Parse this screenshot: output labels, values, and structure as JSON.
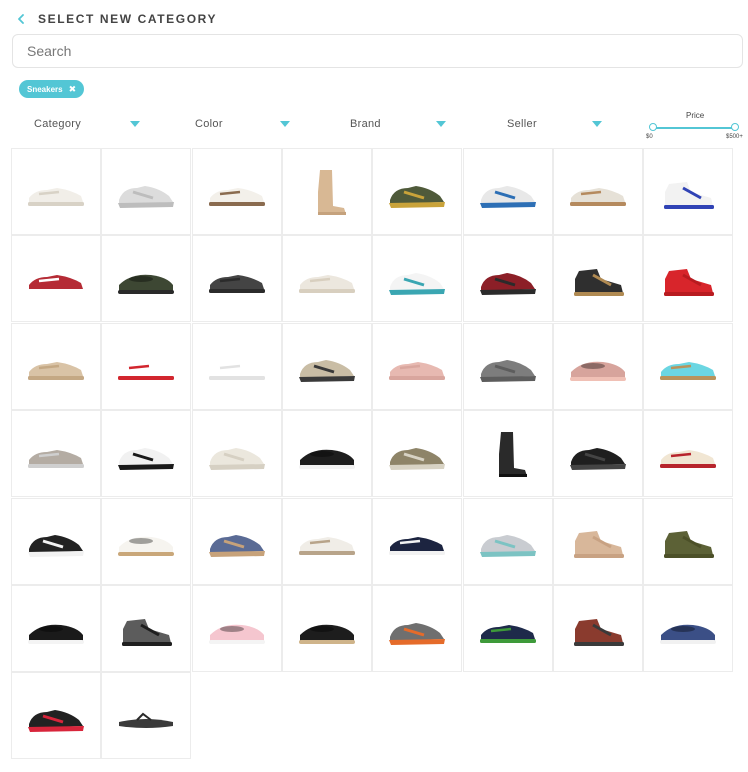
{
  "header": {
    "title": "SELECT NEW CATEGORY",
    "back_icon": "chevron-left-icon"
  },
  "search": {
    "placeholder": "Search",
    "value": ""
  },
  "active_filter": {
    "label": "Sneakers",
    "remove_icon": "close-icon"
  },
  "filters": [
    {
      "label": "Category"
    },
    {
      "label": "Color"
    },
    {
      "label": "Brand"
    },
    {
      "label": "Seller"
    }
  ],
  "price": {
    "label": "Price",
    "min_label": "$0",
    "max_label": "$500+"
  },
  "colors": {
    "accent": "#53c6d5"
  },
  "products": [
    {
      "kind": "sneaker",
      "colors": [
        "#f1eee8",
        "#d8d2c6"
      ]
    },
    {
      "kind": "runner",
      "colors": [
        "#dcdcdc",
        "#bdbdbd"
      ]
    },
    {
      "kind": "sneaker",
      "colors": [
        "#f3f0ea",
        "#8a6b4f"
      ]
    },
    {
      "kind": "boot",
      "colors": [
        "#d8b894",
        "#c5a27d"
      ]
    },
    {
      "kind": "runner",
      "colors": [
        "#4f5a3a",
        "#c9a33a"
      ]
    },
    {
      "kind": "runner",
      "colors": [
        "#e8e8e8",
        "#2d6fb5"
      ]
    },
    {
      "kind": "sneaker",
      "colors": [
        "#e6e1d7",
        "#b58a5e"
      ]
    },
    {
      "kind": "hightop",
      "colors": [
        "#f2f2f2",
        "#3043b5"
      ]
    },
    {
      "kind": "sneaker",
      "colors": [
        "#b52b35",
        "#ffffff"
      ]
    },
    {
      "kind": "slipon",
      "colors": [
        "#3d4733",
        "#2a2a2a"
      ]
    },
    {
      "kind": "sneaker",
      "colors": [
        "#444444",
        "#2b2b2b"
      ]
    },
    {
      "kind": "sneaker",
      "colors": [
        "#ece7de",
        "#d8cfbf"
      ]
    },
    {
      "kind": "runner",
      "colors": [
        "#f4f4f4",
        "#3aa6b2"
      ]
    },
    {
      "kind": "runner",
      "colors": [
        "#8c1f27",
        "#2b2b2b"
      ]
    },
    {
      "kind": "hightop",
      "colors": [
        "#2f2f2f",
        "#b08a52"
      ]
    },
    {
      "kind": "hightop",
      "colors": [
        "#d8252b",
        "#b81b20"
      ]
    },
    {
      "kind": "sneaker",
      "colors": [
        "#d9c3a6",
        "#c4a884"
      ]
    },
    {
      "kind": "sneaker",
      "colors": [
        "#ffffff",
        "#d2262e"
      ]
    },
    {
      "kind": "sneaker",
      "colors": [
        "#ffffff",
        "#e2e2e2"
      ]
    },
    {
      "kind": "runner",
      "colors": [
        "#c9bda5",
        "#3a3a3a"
      ]
    },
    {
      "kind": "sneaker",
      "colors": [
        "#e7b9b1",
        "#d9a69e"
      ]
    },
    {
      "kind": "runner",
      "colors": [
        "#7d7d7d",
        "#5d5d5d"
      ]
    },
    {
      "kind": "slipon",
      "colors": [
        "#d7a49c",
        "#f0c0b5"
      ]
    },
    {
      "kind": "sneaker",
      "colors": [
        "#6bd6e2",
        "#b9935b"
      ]
    },
    {
      "kind": "sneaker",
      "colors": [
        "#b4aca3",
        "#cfcfcf"
      ]
    },
    {
      "kind": "runner",
      "colors": [
        "#f1f1f1",
        "#1a1a1a"
      ]
    },
    {
      "kind": "runner",
      "colors": [
        "#ebe7dd",
        "#d6d0c3"
      ]
    },
    {
      "kind": "slipon",
      "colors": [
        "#1e1e1e",
        "#f3f3f3"
      ]
    },
    {
      "kind": "runner",
      "colors": [
        "#8e8468",
        "#d8d3c4"
      ]
    },
    {
      "kind": "boot",
      "colors": [
        "#2a2a2a",
        "#111111"
      ]
    },
    {
      "kind": "runner",
      "colors": [
        "#1f1f1f",
        "#444444"
      ]
    },
    {
      "kind": "sneaker",
      "colors": [
        "#f1e6d3",
        "#b7242c"
      ]
    },
    {
      "kind": "runner",
      "colors": [
        "#222222",
        "#f2f2f2"
      ]
    },
    {
      "kind": "slipon",
      "colors": [
        "#f6f4ef",
        "#c9a77a"
      ]
    },
    {
      "kind": "runner",
      "colors": [
        "#5a6b95",
        "#c7a27a"
      ]
    },
    {
      "kind": "sneaker",
      "colors": [
        "#f0ede7",
        "#b8a48a"
      ]
    },
    {
      "kind": "sneaker",
      "colors": [
        "#1c2440",
        "#f2f2f2"
      ]
    },
    {
      "kind": "runner",
      "colors": [
        "#c9ccd1",
        "#7cc3c3"
      ]
    },
    {
      "kind": "hightop",
      "colors": [
        "#d8b79a",
        "#c8a283"
      ]
    },
    {
      "kind": "hightop",
      "colors": [
        "#5c6136",
        "#4c5028"
      ]
    },
    {
      "kind": "slipon",
      "colors": [
        "#1a1a1a",
        "#f4f4f4"
      ]
    },
    {
      "kind": "hightop",
      "colors": [
        "#5c5c5c",
        "#1f1f1f"
      ]
    },
    {
      "kind": "slipon",
      "colors": [
        "#f5c6cf",
        "#f4f4f4"
      ]
    },
    {
      "kind": "slipon",
      "colors": [
        "#1d1d1d",
        "#cfb48a"
      ]
    },
    {
      "kind": "runner",
      "colors": [
        "#6f6f6f",
        "#e56b2a"
      ]
    },
    {
      "kind": "sneaker",
      "colors": [
        "#1e2a4a",
        "#3e9a3a"
      ]
    },
    {
      "kind": "hightop",
      "colors": [
        "#8a3b2e",
        "#3a3a3a"
      ]
    },
    {
      "kind": "slipon",
      "colors": [
        "#3b4f86",
        "#f1f1f1"
      ]
    },
    {
      "kind": "runner",
      "colors": [
        "#222222",
        "#d8253b"
      ]
    },
    {
      "kind": "sandal",
      "colors": [
        "#3a3a3a",
        "#2a2a2a"
      ]
    }
  ]
}
